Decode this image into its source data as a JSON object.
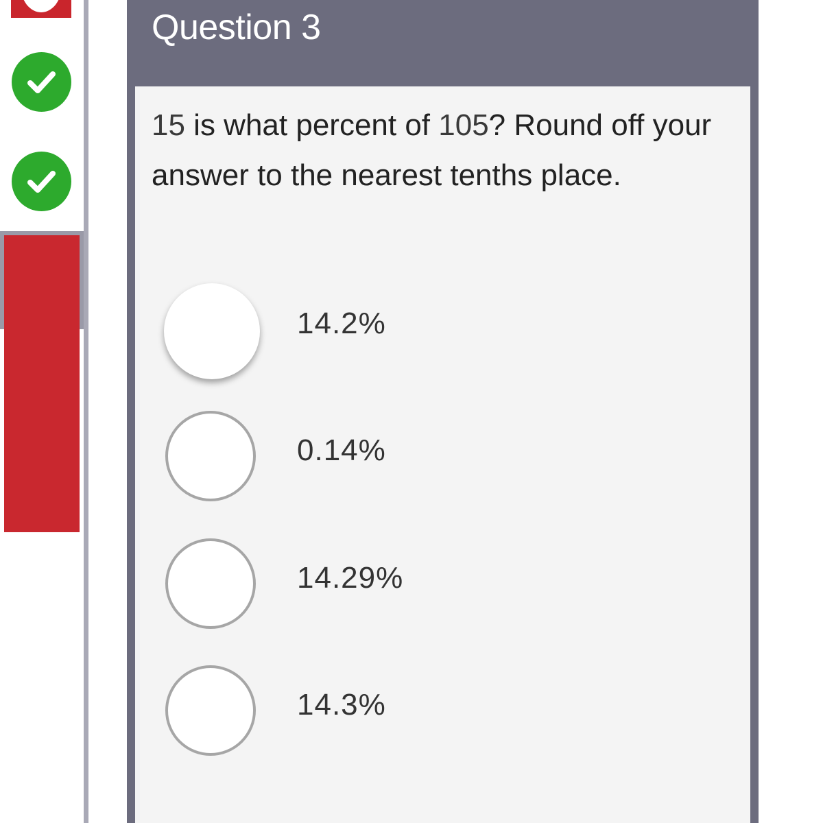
{
  "nav": {
    "items": [
      {
        "status": "incorrect",
        "icon": "x-icon"
      },
      {
        "status": "correct",
        "icon": "check-icon"
      },
      {
        "status": "correct",
        "icon": "check-icon"
      },
      {
        "status": "current"
      }
    ],
    "colors": {
      "correct": "#2daa2d",
      "incorrect": "#c9252c"
    }
  },
  "question": {
    "title": "Question 3",
    "prompt_num1": "15",
    "prompt_mid": " is what percent of ",
    "prompt_num2": "105",
    "prompt_end": "? Round off your answer to the nearest tenths place.",
    "options": [
      {
        "label": "14.2%",
        "selected": false
      },
      {
        "label": "0.14%",
        "selected": false
      },
      {
        "label": "14.29%",
        "selected": false
      },
      {
        "label": "14.3%",
        "selected": false
      }
    ]
  },
  "colors": {
    "header_bg": "#6c6c7e",
    "body_bg": "#f4f4f4",
    "radio_border": "#a6a6a6"
  }
}
